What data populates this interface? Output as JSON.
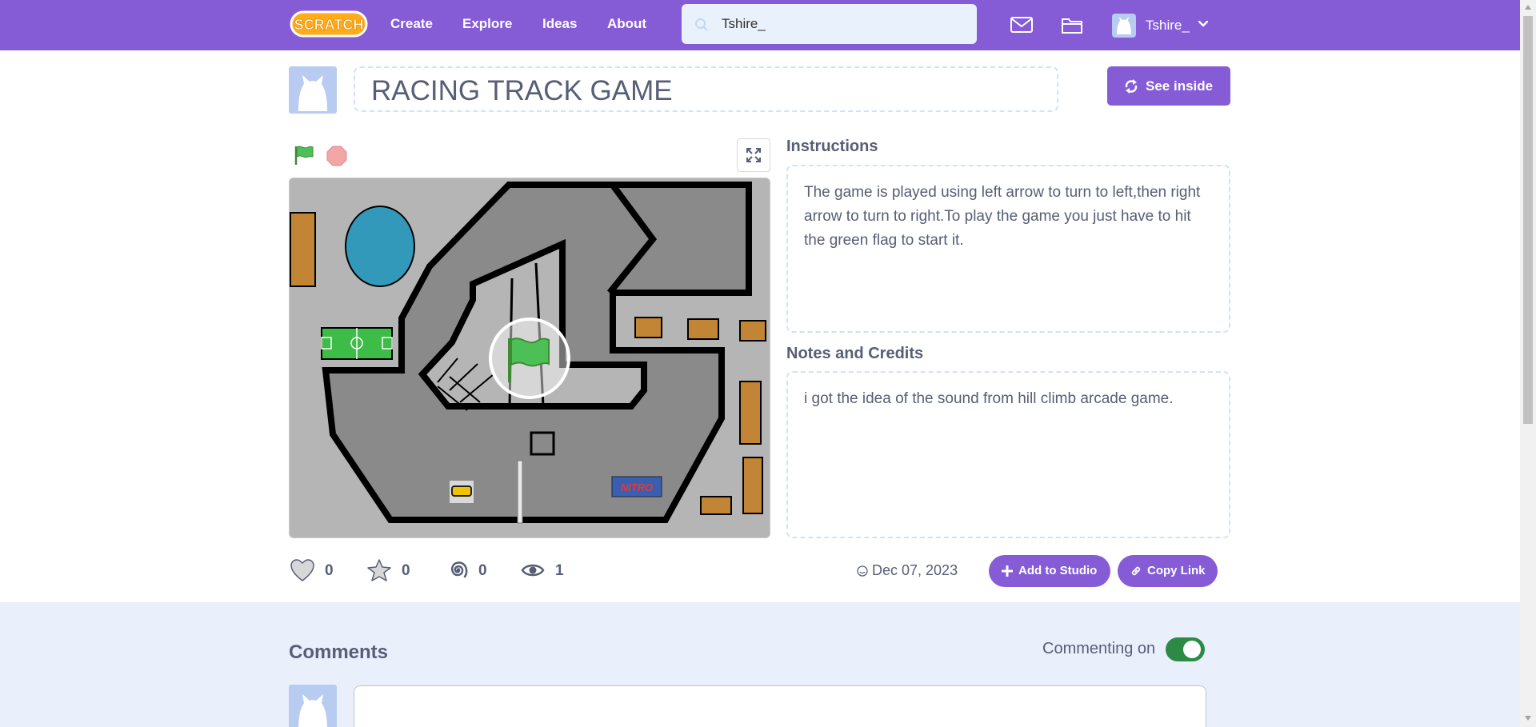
{
  "nav": {
    "logo_text": "SCRATCH",
    "links": {
      "create": "Create",
      "explore": "Explore",
      "ideas": "Ideas",
      "about": "About"
    },
    "search_value": "Tshire_",
    "username": "Tshire_",
    "icons": [
      "messages-icon",
      "my-stuff-folder-icon",
      "chevron-down-icon"
    ]
  },
  "project": {
    "title": "RACING TRACK GAME",
    "see_inside_label": "See inside"
  },
  "stage": {
    "sign_text": "NITRO",
    "controls": [
      "green-flag-icon",
      "stop-icon",
      "fullscreen-icon"
    ]
  },
  "instructions": {
    "heading": "Instructions",
    "text": "The game is played using left arrow to turn to left,then right arrow to turn to right.To play the game you just have to hit the green flag to start it."
  },
  "notes": {
    "heading": "Notes and Credits",
    "text": "i got the idea of the sound from hill climb arcade game."
  },
  "stats": {
    "loves": "0",
    "favorites": "0",
    "remixes": "0",
    "views": "1",
    "date": "Dec 07, 2023"
  },
  "actions": {
    "add_to_studio": "Add to Studio",
    "copy_link": "Copy Link"
  },
  "comments": {
    "heading": "Comments",
    "commenting_label": "Commenting on",
    "commenting_enabled": true
  },
  "colors": {
    "brand_purple": "#855cd6",
    "search_bg": "#e9f1fc",
    "toggle_green": "#2c8a46",
    "comments_bg": "#e9f0fc"
  }
}
